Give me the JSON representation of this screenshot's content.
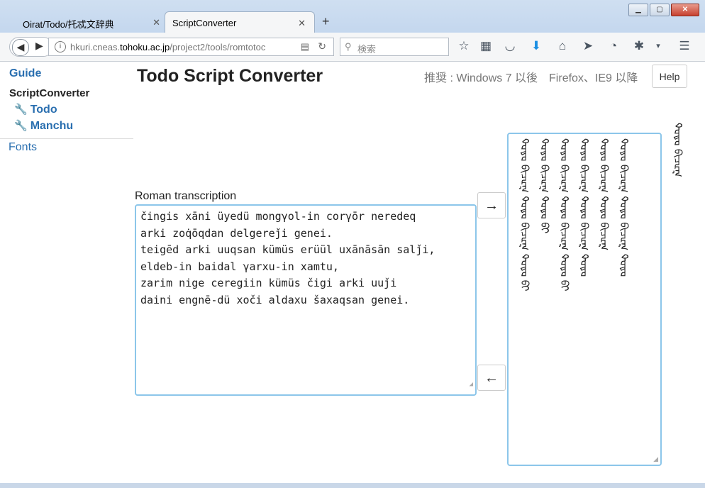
{
  "browser": {
    "tabs": [
      {
        "label": "Oirat/Todo/托忒文辞典",
        "active": false
      },
      {
        "label": "ScriptConverter",
        "active": true
      }
    ],
    "new_tab": "+",
    "url_prefix": "hkuri.cneas.",
    "url_domain": "tohoku.ac.jp",
    "url_path": "/project2/tools/romtotoc",
    "search_placeholder": "検索"
  },
  "sidebar": {
    "guide": "Guide",
    "section": "ScriptConverter",
    "items": [
      "Todo",
      "Manchu"
    ],
    "fonts": "Fonts"
  },
  "header": {
    "title": "Todo Script Converter",
    "recommend": "推奨 : Windows 7 以後　Firefox、IE9 以降",
    "help": "Help"
  },
  "converter": {
    "roman_label": "Roman transcription",
    "roman_lines": [
      "čingis xāni üyedü mongγol-in corγōr neredeq",
      "arki zoq̇ōqdan delgereǰi genei.",
      "teigēd arki uuqsan kümüs erüül uxānāsān salǰi,",
      "eldeb-in baidal γarxu-in xamtu,",
      "zarim nige ceregiin kümüs čigi arki uuǰi",
      "daini engnē-dü xoči aldaxu šaxaqsan genei."
    ],
    "to_script_button": "→",
    "to_roman_button": "←",
    "output_label": "ᡐᡆᡑᡆ ᡋᠢᠴᡅᡎ"
  }
}
